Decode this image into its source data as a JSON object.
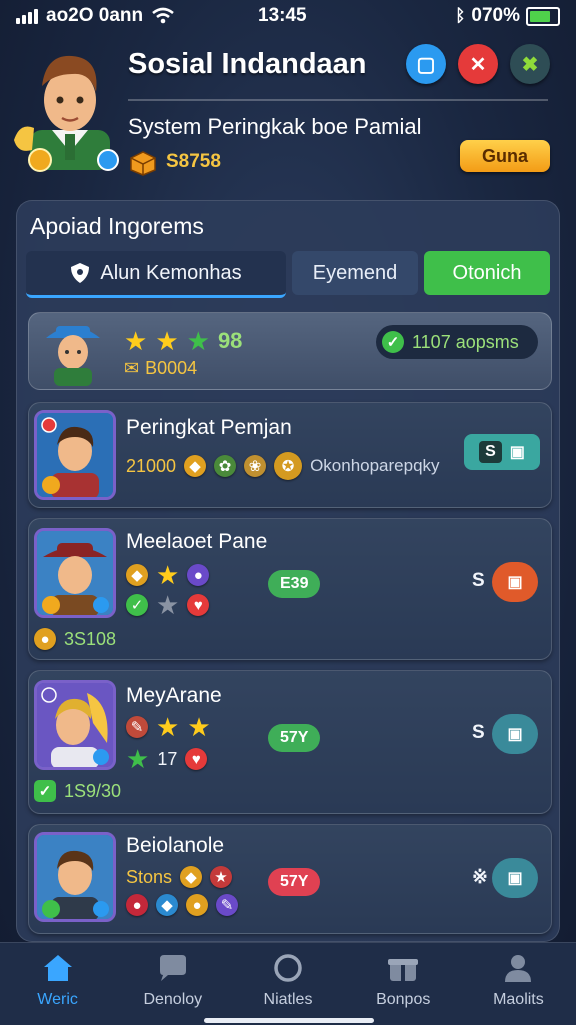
{
  "status_bar": {
    "carrier": "ao2O 0ann",
    "time": "13:45",
    "battery_percent": "070%"
  },
  "header": {
    "title": "Sosial Indandaan",
    "subtitle": "System Peringkak boe Pamial",
    "coins": "S8758",
    "gold_button_label": "Guna",
    "accent_colors": {
      "blue": "#2b9af0",
      "red": "#e53a3a",
      "green": "#3fbf4a",
      "gold": "#f5b02a"
    }
  },
  "panel": {
    "title": "Apoiad Ingorems",
    "tabs": [
      {
        "label": "Alun Kemonhas",
        "icon": "shield-icon"
      },
      {
        "label": "Eyemend"
      },
      {
        "label": "Otonich"
      }
    ]
  },
  "my_row": {
    "score": "98",
    "points": "B0004",
    "pill_text": "1107 aopsms"
  },
  "players": [
    {
      "name": "Peringkat Pemjan",
      "score": "21000",
      "caption": "Okonhoparepqky",
      "tag": "S",
      "tag_color": "#3fbf4a"
    },
    {
      "name": "Meelaoet Pane",
      "level_tag": "E39",
      "points": "3S108",
      "side_value": "S",
      "tag_color": "#3fbf4a"
    },
    {
      "name": "MeyArane",
      "level_tag": "57Y",
      "points": "1S9/30",
      "side_value": "S",
      "sub_value": "17",
      "tag_color": "#3fbf4a"
    },
    {
      "name": "Beiolanole",
      "level_tag": "57Y",
      "points_label": "Stons",
      "side_value": "※",
      "tag_color": "#e04152"
    }
  ],
  "nav": [
    {
      "label": "Weric",
      "icon": "home-icon",
      "active": true
    },
    {
      "label": "Denoloy",
      "icon": "chat-icon"
    },
    {
      "label": "Niatles",
      "icon": "circle-icon"
    },
    {
      "label": "Bonpos",
      "icon": "gift-icon"
    },
    {
      "label": "Maolits",
      "icon": "user-icon"
    }
  ]
}
